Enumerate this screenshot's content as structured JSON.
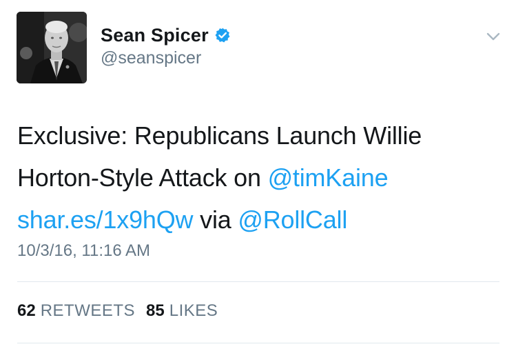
{
  "author": {
    "display_name": "Sean Spicer",
    "handle": "@seanspicer",
    "verified": true,
    "avatar_icon": "profile-photo"
  },
  "tweet": {
    "line1": "Exclusive: Republicans Launch Willie",
    "line2_text": "Horton-Style Attack on ",
    "mention_timkaine": "@timKaine",
    "link_url_text": "shar.es/1x9hQw",
    "via_text": " via ",
    "mention_rollcall": "@RollCall"
  },
  "timestamp": "10/3/16, 11:16 AM",
  "stats": {
    "retweets_count": "62",
    "retweets_label": "RETWEETS",
    "likes_count": "85",
    "likes_label": "LIKES"
  },
  "colors": {
    "link": "#1da1f2",
    "secondary_text": "#657786",
    "primary_text": "#14171a",
    "divider": "#e1e8ed",
    "verified_badge": "#1da1f2"
  }
}
